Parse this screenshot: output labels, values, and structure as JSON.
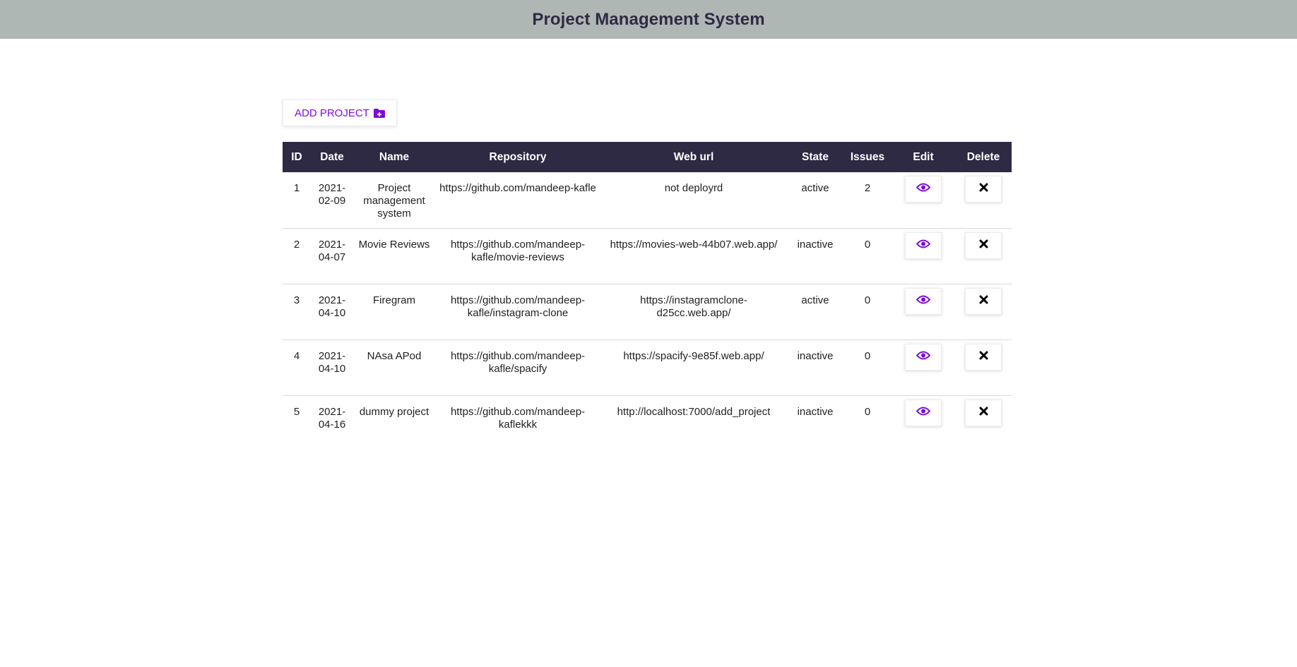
{
  "header": {
    "title": "Project Management System"
  },
  "toolbar": {
    "add_label": "ADD PROJECT",
    "add_icon": "folder-plus-icon",
    "accent": "#7e0ad9"
  },
  "table": {
    "columns": [
      "ID",
      "Date",
      "Name",
      "Repository",
      "Web url",
      "State",
      "Issues",
      "Edit",
      "Delete"
    ],
    "rows": [
      {
        "id": "1",
        "date": "2021-02-09",
        "name": "Project management system",
        "repository": "https://github.com/mandeep-kafle",
        "web_url": "not deployrd",
        "state": "active",
        "issues": "2"
      },
      {
        "id": "2",
        "date": "2021-04-07",
        "name": "Movie Reviews",
        "repository": "https://github.com/mandeep-kafle/movie-reviews",
        "web_url": "https://movies-web-44b07.web.app/",
        "state": "inactive",
        "issues": "0"
      },
      {
        "id": "3",
        "date": "2021-04-10",
        "name": "Firegram",
        "repository": "https://github.com/mandeep-kafle/instagram-clone",
        "web_url": "https://instagramclone-d25cc.web.app/",
        "state": "active",
        "issues": "0"
      },
      {
        "id": "4",
        "date": "2021-04-10",
        "name": "NAsa APod",
        "repository": "https://github.com/mandeep-kafle/spacify",
        "web_url": "https://spacify-9e85f.web.app/",
        "state": "inactive",
        "issues": "0"
      },
      {
        "id": "5",
        "date": "2021-04-16",
        "name": "dummy project",
        "repository": "https://github.com/mandeep-kaflekkk",
        "web_url": "http://localhost:7000/add_project",
        "state": "inactive",
        "issues": "0"
      }
    ],
    "edit_icon": "eye-icon",
    "delete_icon": "close-icon"
  },
  "colors": {
    "header_bg": "#aeb7b4",
    "table_head_bg": "#2e2a43",
    "edit_icon": "#7e0ad9",
    "delete_icon": "#000000"
  }
}
